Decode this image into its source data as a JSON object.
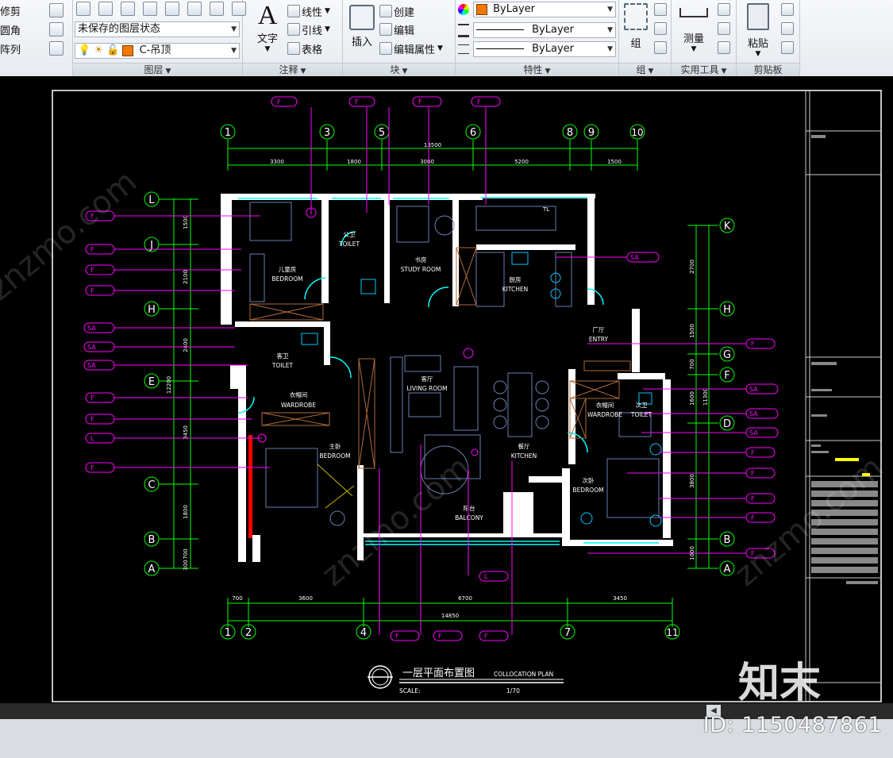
{
  "ribbon": {
    "modify": {
      "trim": "修剪",
      "fillet": "圆角",
      "array": "阵列"
    },
    "layers": {
      "panel_title": "图层",
      "state_combo": "未保存的图层状态",
      "current_layer": "C-吊顶"
    },
    "annotation": {
      "panel_title": "注释",
      "text_label": "文字",
      "linear_label": "线性",
      "leader_label": "引线",
      "table_label": "表格"
    },
    "block": {
      "panel_title": "块",
      "insert_label": "插入",
      "create_label": "创建",
      "edit_label": "编辑",
      "edit_attr_label": "编辑属性"
    },
    "properties": {
      "panel_title": "特性",
      "color": "ByLayer",
      "linetype": "ByLayer",
      "lineweight": "ByLayer",
      "color_swatch": "#f07800"
    },
    "group": {
      "panel_title": "组",
      "group_label": "组"
    },
    "utilities": {
      "panel_title": "实用工具",
      "measure_label": "测量"
    },
    "clipboard": {
      "panel_title": "剪贴板",
      "paste_label": "粘贴"
    }
  },
  "drawing": {
    "grid_top": [
      "1",
      "3",
      "5",
      "6",
      "8",
      "9",
      "10"
    ],
    "grid_bottom": [
      "1",
      "2",
      "4",
      "7",
      "11"
    ],
    "grid_left": [
      "L",
      "J",
      "H",
      "E",
      "C",
      "B",
      "A"
    ],
    "grid_right": [
      "K",
      "H",
      "G",
      "F",
      "D",
      "B",
      "A"
    ],
    "dim_top_total": "13500",
    "dim_top": [
      "3300",
      "1800",
      "3000",
      "5200",
      "1500"
    ],
    "dim_bottom_total": "14850",
    "dim_bottom": [
      "700",
      "3600",
      "6700",
      "3450"
    ],
    "dim_left_total": "12200",
    "dim_left": [
      "1500",
      "2100",
      "2400",
      "3450",
      "1800",
      "700",
      "300"
    ],
    "dim_right_total": "11300",
    "dim_right": [
      "2700",
      "1500",
      "700",
      "1600",
      "3800",
      "1000"
    ],
    "rooms": [
      {
        "cn": "儿童房",
        "en": "BEDROOM"
      },
      {
        "cn": "公卫",
        "en": "TOILET"
      },
      {
        "cn": "书房",
        "en": "STUDY ROOM"
      },
      {
        "cn": "厨房",
        "en": "KITCHEN"
      },
      {
        "cn": "厂厅",
        "en": "ENTRY"
      },
      {
        "cn": "客卫",
        "en": "TOILET"
      },
      {
        "cn": "衣帽间",
        "en": "WARDROBE"
      },
      {
        "cn": "客厅",
        "en": "LIVING ROOM"
      },
      {
        "cn": "餐厅",
        "en": "KITCHEN"
      },
      {
        "cn": "主卧",
        "en": "BEDROOM"
      },
      {
        "cn": "衣帽间",
        "en": "WARDROBE"
      },
      {
        "cn": "次卫",
        "en": "TOILET"
      },
      {
        "cn": "次卧",
        "en": "BEDROOM"
      },
      {
        "cn": "阳台",
        "en": "BALCONY"
      }
    ],
    "tags": [
      "F",
      "F",
      "F",
      "F",
      "F",
      "F",
      "F",
      "SA",
      "SA",
      "SA",
      "L",
      "F",
      "SA",
      "SA",
      "SA",
      "F",
      "F",
      "F",
      "F",
      "F",
      "L",
      "F",
      "F",
      "F"
    ],
    "tag_letters": {
      "f": "F",
      "sa": "SA",
      "l": "L"
    },
    "title_cn": "一层平面布置图",
    "title_en": "COLLOCATION PLAN",
    "scale_label": "SCALE:",
    "scale_value": "1/70",
    "legend_mini": "TL"
  },
  "watermark": {
    "site": "znzmo.com",
    "logo": "知末",
    "id_text": "ID: 1150487861"
  }
}
